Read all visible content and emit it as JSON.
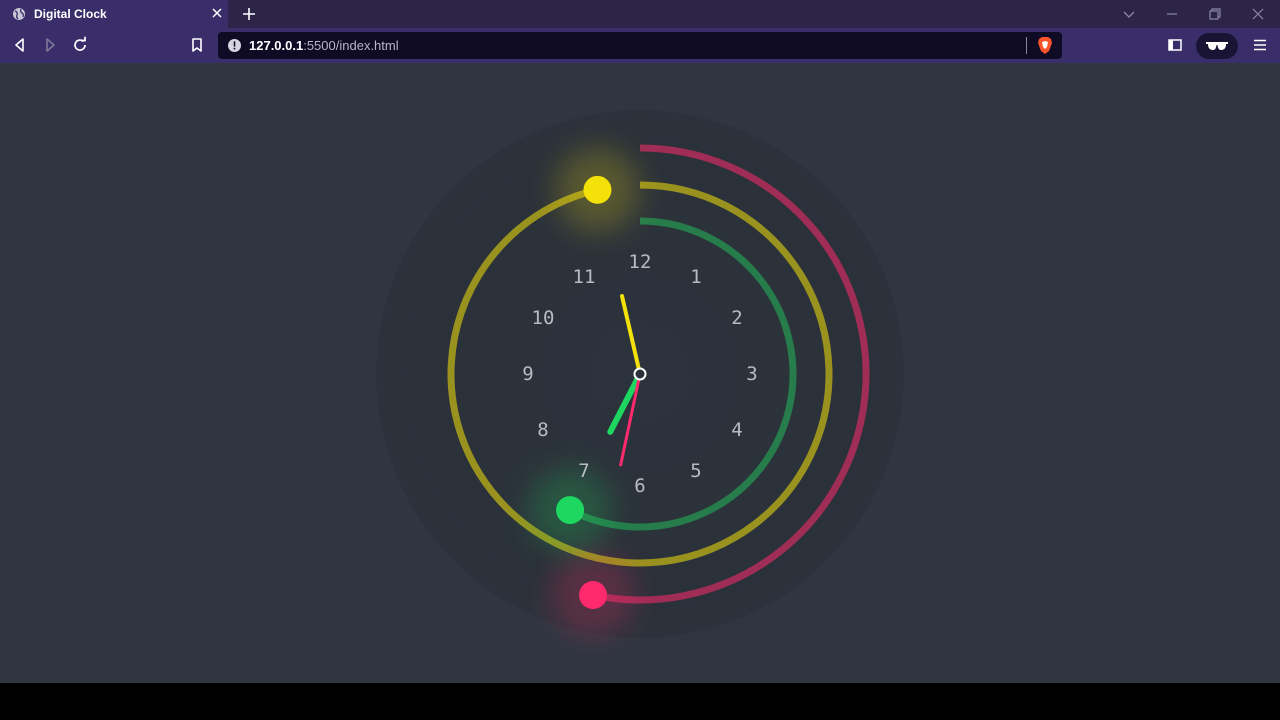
{
  "browser": {
    "tab_title": "Digital Clock",
    "url_host": "127.0.0.1",
    "url_rest": ":5500/index.html"
  },
  "clock": {
    "numbers": [
      "12",
      "1",
      "2",
      "3",
      "4",
      "5",
      "6",
      "7",
      "8",
      "9",
      "10",
      "11"
    ],
    "time": {
      "hours": 11,
      "minutes": 34,
      "seconds": 32
    },
    "colors": {
      "hours": "#f5e10a",
      "minutes": "#1ed760",
      "seconds": "#ff2a6d",
      "background": "#2f3640",
      "face": "#2c323b",
      "numbers": "#b7bcc4"
    }
  }
}
